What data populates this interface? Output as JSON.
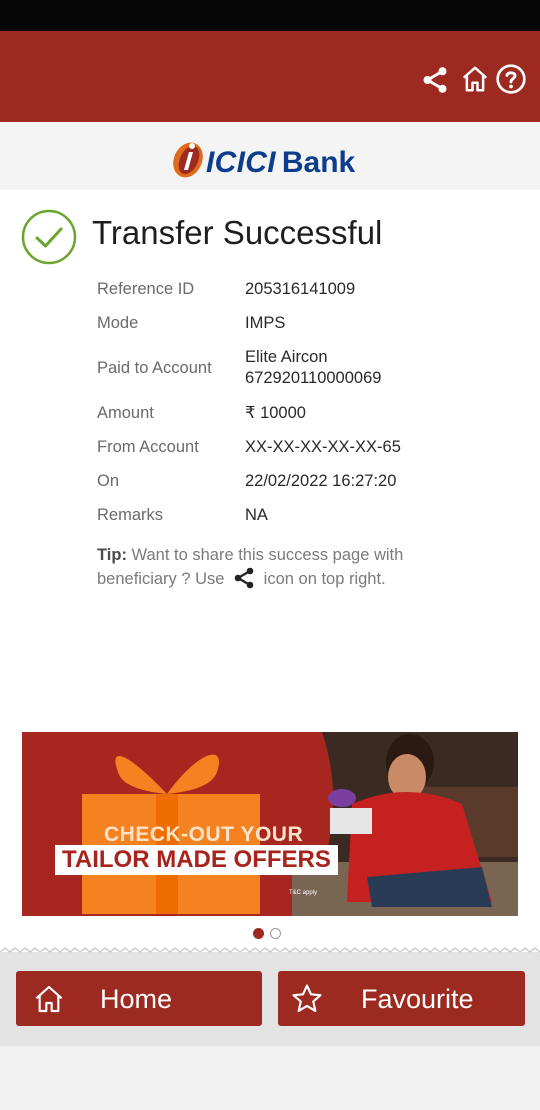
{
  "header": {
    "icons": [
      "share-icon",
      "home-icon",
      "help-icon"
    ],
    "background_color": "#9c2a20"
  },
  "logo": {
    "text": "ICICI",
    "text2": "Bank",
    "brand_color": "#0c3c8c",
    "accent_color": "#e06a1a"
  },
  "status": {
    "title": "Transfer Successful",
    "check_color": "#6aa52c"
  },
  "details": [
    {
      "label": "Reference ID",
      "value": "205316141009"
    },
    {
      "label": "Mode",
      "value": "IMPS"
    },
    {
      "label": "Paid to Account",
      "value": "Elite Aircon",
      "value2": "672920110000069"
    },
    {
      "label": "Amount",
      "value": "₹ 10000"
    },
    {
      "label": "From Account",
      "value": "XX-XX-XX-XX-XX-65"
    },
    {
      "label": "On",
      "value": "22/02/2022 16:27:20"
    },
    {
      "label": "Remarks",
      "value": "NA"
    }
  ],
  "tip": {
    "label": "Tip:",
    "text_before": " Want to share this success page with beneficiary ? Use ",
    "text_after": " icon on top right."
  },
  "banner": {
    "line1": "CHECK-OUT YOUR",
    "line2": "TAILOR MADE OFFERS",
    "fine_print": "T&C apply"
  },
  "carousel": {
    "total": 2,
    "active": 1
  },
  "bottom_nav": {
    "home_label": "Home",
    "favourite_label": "Favourite"
  }
}
